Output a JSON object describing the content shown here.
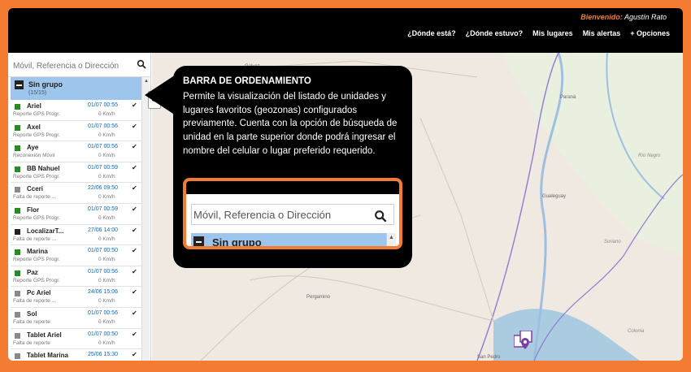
{
  "header": {
    "welcome_label": "Bienvenido:",
    "user_name": "Agustín Rato",
    "nav": [
      "¿Dónde está?",
      "¿Dónde estuvo?",
      "Mis lugares",
      "Mis alertas",
      "+ Opciones"
    ]
  },
  "sidebar": {
    "search_placeholder": "Móvil, Referencia o Dirección",
    "group": {
      "name": "Sin grupo",
      "count": "(15/15)"
    },
    "items": [
      {
        "name": "Ariel",
        "date": "01/07 00:55",
        "status": "Reporte GPS Progr.",
        "speed": "0 Km/h",
        "color": "#2a8a2a"
      },
      {
        "name": "Axel",
        "date": "01/07 00:56",
        "status": "Reporte GPS Progr.",
        "speed": "0 Km/h",
        "color": "#2a8a2a"
      },
      {
        "name": "Aye",
        "date": "01/07 00:56",
        "status": "Reconexión Móvil",
        "speed": "0 Km/h",
        "color": "#2a8a2a"
      },
      {
        "name": "BB Nahuel",
        "date": "01/07 00:59",
        "status": "Reporte GPS Progr.",
        "speed": "0 Km/h",
        "color": "#2a8a2a"
      },
      {
        "name": "Cceri",
        "date": "22/06 09:50",
        "status": "Falta de reporte ...",
        "speed": "0 Km/h",
        "color": "#8a8a8a"
      },
      {
        "name": "Flor",
        "date": "01/07 00:59",
        "status": "Reporte GPS Progr.",
        "speed": "0 Km/h",
        "color": "#2a8a2a"
      },
      {
        "name": "LocalizarT...",
        "date": "27/06 14:00",
        "status": "Falta de reporte ...",
        "speed": "0 Km/h",
        "color": "#222222"
      },
      {
        "name": "Marina",
        "date": "01/07 00:50",
        "status": "Reporte GPS Progr.",
        "speed": "0 Km/h",
        "color": "#2a8a2a"
      },
      {
        "name": "Paz",
        "date": "01/07 00:56",
        "status": "Reporte GPS Progr.",
        "speed": "0 Km/h",
        "color": "#2a8a2a"
      },
      {
        "name": "Pc Ariel",
        "date": "24/06 15:06",
        "status": "Falta de reporte ...",
        "speed": "0 Km/h",
        "color": "#8a8a8a"
      },
      {
        "name": "Sol",
        "date": "01/07 00:56",
        "status": "Falta de reporte",
        "speed": "0 Km/h",
        "color": "#8a8a8a"
      },
      {
        "name": "Tablet Ariel",
        "date": "01/07 00:50",
        "status": "Falta de reporte",
        "speed": "0 Km/h",
        "color": "#8a8a8a"
      },
      {
        "name": "Tablet Marina",
        "date": "25/06 15:30",
        "status": "",
        "speed": "",
        "color": "#8a8a8a"
      }
    ]
  },
  "tooltip": {
    "title": "BARRA DE ORDENAMIENTO",
    "body": "Permite la visualización del listado de unidades y lugares favoritos (geozonas) configurados previamente. Cuenta con la opción de búsqueda de unidad en la parte superior donde podrá ingresar el nombre del celular o lugar preferido requerido.",
    "zoom_placeholder": "Móvil, Referencia o Dirección",
    "zoom_group": "Sin grupo"
  },
  "map": {
    "labels": [
      "Galvez",
      "Paraná",
      "Río Negro",
      "Gualeguay",
      "Pergamino",
      "Colonia",
      "Soriano",
      "San Pedro"
    ]
  },
  "icons": [
    "search-icon",
    "check-icon",
    "chevron-left-icon",
    "minus-box-icon",
    "map-marker-icon"
  ],
  "colors": {
    "accent": "#f47b32",
    "selected": "#9ec6ec",
    "link": "#1a64b4"
  }
}
